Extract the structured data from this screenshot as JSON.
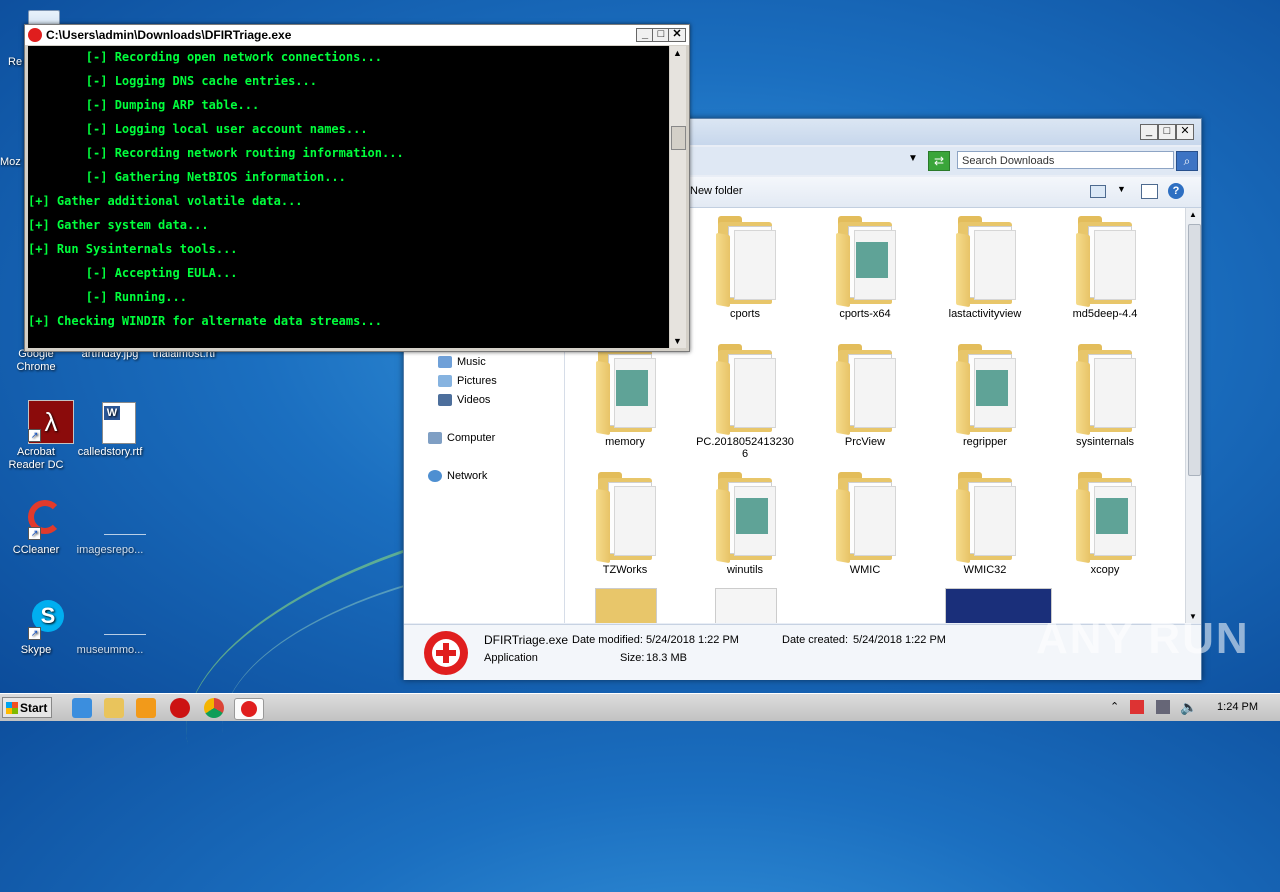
{
  "desktop": {
    "icons": [
      {
        "label": "Re",
        "name": "recycle-bin"
      },
      {
        "label": "Moz",
        "name": "mozilla-firefox"
      },
      {
        "label": "Google\nChrome",
        "name": "google-chrome"
      },
      {
        "label": "artfriday.jpg",
        "name": "artfriday-file"
      },
      {
        "label": "trialalmost.rtf",
        "name": "trialalmost-file"
      },
      {
        "label": "Acrobat\nReader DC",
        "name": "acrobat-reader"
      },
      {
        "label": "calledstory.rtf",
        "name": "calledstory-file"
      },
      {
        "label": "CCleaner",
        "name": "ccleaner"
      },
      {
        "label": "imagesrepo...",
        "name": "imagesrepo-file"
      },
      {
        "label": "Skype",
        "name": "skype"
      },
      {
        "label": "museummo...",
        "name": "museummo-file"
      }
    ]
  },
  "console": {
    "title": "C:\\Users\\admin\\Downloads\\DFIRTriage.exe",
    "lines": [
      "        [-] Recording open network connections...",
      "        [-] Logging DNS cache entries...",
      "        [-] Dumping ARP table...",
      "        [-] Logging local user account names...",
      "        [-] Recording network routing information...",
      "        [-] Gathering NetBIOS information...",
      "[+] Gather additional volatile data...",
      "[+] Gather system data...",
      "[+] Run Sysinternals tools...",
      "        [-] Accepting EULA...",
      "        [-] Running...",
      "[+] Checking WINDIR for alternate data streams..."
    ]
  },
  "explorer": {
    "search_placeholder": "Search Downloads",
    "toolbar": {
      "new_folder": "New folder"
    },
    "nav": [
      "Music",
      "Pictures",
      "Videos",
      "Computer",
      "Network"
    ],
    "folders": [
      {
        "label": "cports"
      },
      {
        "label": "cports-x64"
      },
      {
        "label": "lastactivityview"
      },
      {
        "label": "md5deep-4.4"
      },
      {
        "label": "memory"
      },
      {
        "label": "PC.2018052413230\n6"
      },
      {
        "label": "PrcView"
      },
      {
        "label": "regripper"
      },
      {
        "label": "sysinternals"
      },
      {
        "label": "TZWorks"
      },
      {
        "label": "winutils"
      },
      {
        "label": "WMIC"
      },
      {
        "label": "WMIC32"
      },
      {
        "label": "xcopy"
      }
    ],
    "details": {
      "filename": "DFIRTriage.exe",
      "type": "Application",
      "modified_label": "Date modified:",
      "modified_value": "5/24/2018 1:22 PM",
      "size_label": "Size:",
      "size_value": "18.3 MB",
      "created_label": "Date created:",
      "created_value": "5/24/2018 1:22 PM"
    }
  },
  "taskbar": {
    "start_label": "Start",
    "clock": "1:24 PM"
  },
  "watermark": "ANY RUN",
  "colors": {
    "console_text": "#00ff3c",
    "console_bg": "#000000",
    "desktop_bg": "#1b6fc0"
  }
}
